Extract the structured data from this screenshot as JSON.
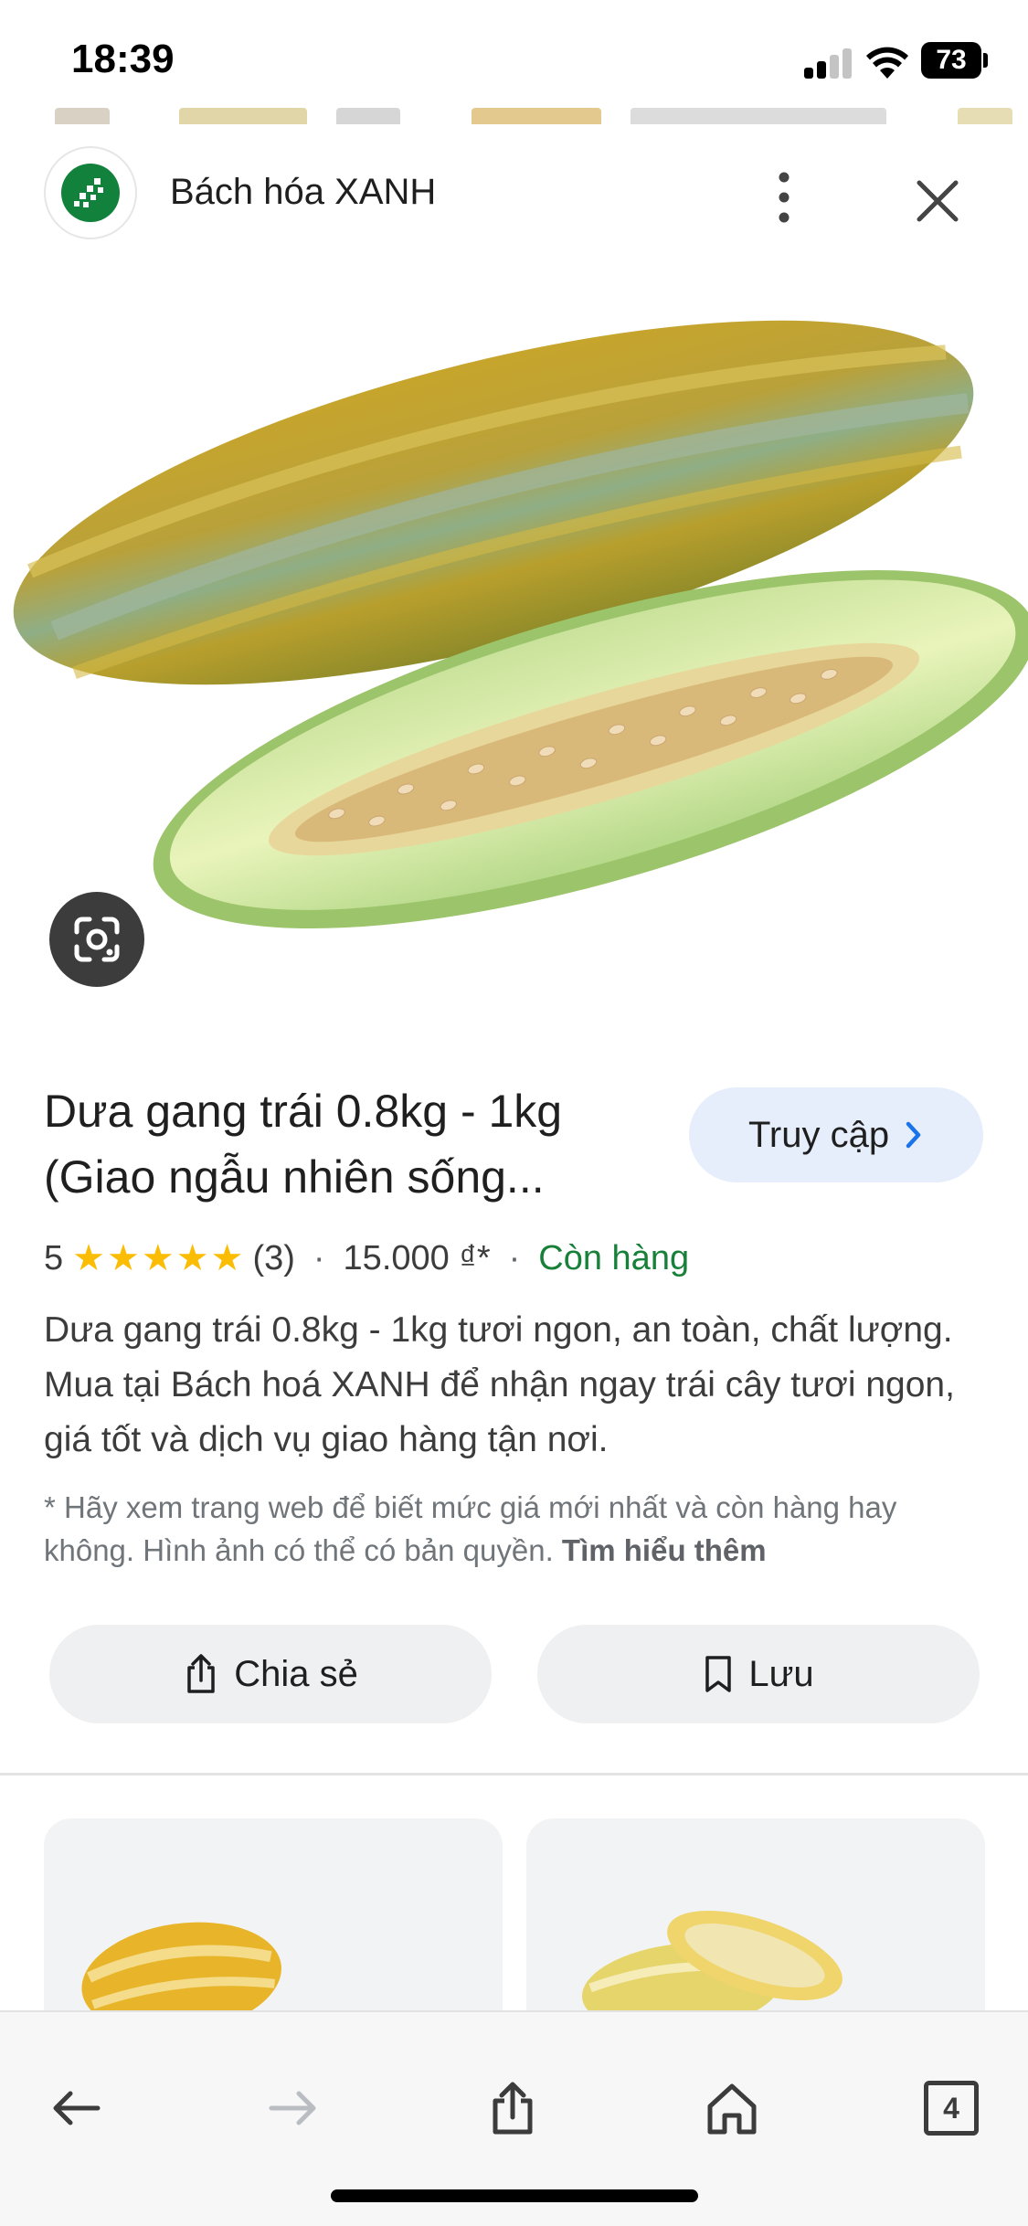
{
  "status_bar": {
    "time": "18:39",
    "battery": "73",
    "icons": [
      "signal-icon",
      "wifi-icon",
      "battery-icon"
    ]
  },
  "header": {
    "site_name": "Bách hóa XANH",
    "logo_icon": "bach-hoa-xanh-logo",
    "more_icon": "more-vert-icon",
    "close_icon": "close-icon"
  },
  "hero": {
    "image_subject": "product-image",
    "lens_icon": "google-lens-icon"
  },
  "product": {
    "title": "Dưa gang trái 0.8kg - 1kg (Giao ngẫu nhiên sống...",
    "visit_label": "Truy cập",
    "rating_value": "5",
    "rating_stars": 5,
    "review_count": "(3)",
    "price": "15.000 ₫*",
    "availability": "Còn hàng",
    "description": "Dưa gang trái 0.8kg - 1kg tươi ngon, an toàn, chất lượng. Mua tại Bách hoá XANH để nhận ngay trái cây tươi ngon, giá tốt và dịch vụ giao hàng tận nơi.",
    "disclaimer": "* Hãy xem trang web để biết mức giá mới nhất và còn hàng hay không. Hình ảnh có thể có bản quyền.",
    "learn_more": "Tìm hiểu thêm"
  },
  "actions": {
    "share_label": "Chia sẻ",
    "save_label": "Lưu"
  },
  "toolbar": {
    "back_icon": "back-arrow-icon",
    "forward_icon": "forward-arrow-icon",
    "share_icon": "share-icon",
    "home_icon": "home-icon",
    "tabs_count": "4"
  },
  "colors": {
    "accent_green": "#188038",
    "star": "#fbbc04",
    "visit_bg": "#e6eefc",
    "logo_green": "#12813c"
  }
}
